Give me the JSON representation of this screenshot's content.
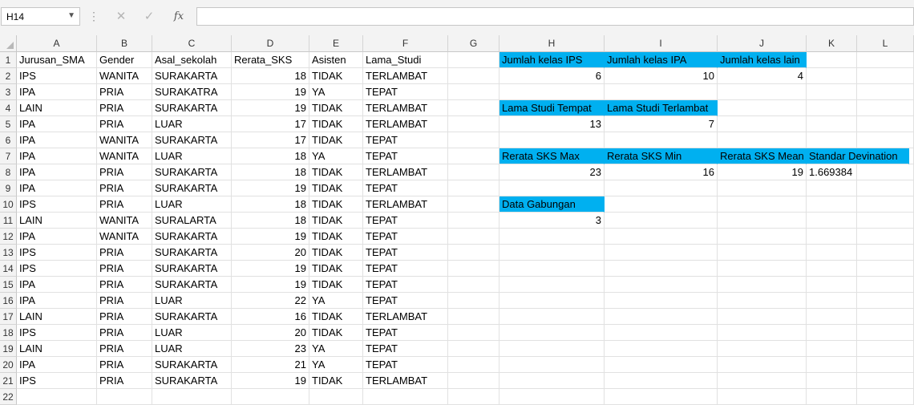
{
  "name_box": {
    "value": "H14"
  },
  "formula_bar": {
    "value": ""
  },
  "columns": [
    "A",
    "B",
    "C",
    "D",
    "E",
    "F",
    "G",
    "H",
    "I",
    "J",
    "K",
    "L"
  ],
  "rows": [
    "1",
    "2",
    "3",
    "4",
    "5",
    "6",
    "7",
    "8",
    "9",
    "10",
    "11",
    "12",
    "13",
    "14",
    "15",
    "16",
    "17",
    "18",
    "19",
    "20",
    "21",
    "22"
  ],
  "table": {
    "headers": [
      "Jurusan_SMA",
      "Gender",
      "Asal_sekolah",
      "Rerata_SKS",
      "Asisten",
      "Lama_Studi"
    ],
    "data": [
      [
        "IPS",
        "WANITA",
        "SURAKARTA",
        "18",
        "TIDAK",
        "TERLAMBAT"
      ],
      [
        "IPA",
        "PRIA",
        "SURAKATRA",
        "19",
        "YA",
        "TEPAT"
      ],
      [
        "LAIN",
        "PRIA",
        "SURAKARTA",
        "19",
        "TIDAK",
        "TERLAMBAT"
      ],
      [
        "IPA",
        "PRIA",
        "LUAR",
        "17",
        "TIDAK",
        "TERLAMBAT"
      ],
      [
        "IPA",
        "WANITA",
        "SURAKARTA",
        "17",
        "TIDAK",
        "TEPAT"
      ],
      [
        "IPA",
        "WANITA",
        "LUAR",
        "18",
        "YA",
        "TEPAT"
      ],
      [
        "IPA",
        "PRIA",
        "SURAKARTA",
        "18",
        "TIDAK",
        "TERLAMBAT"
      ],
      [
        "IPA",
        "PRIA",
        "SURAKARTA",
        "19",
        "TIDAK",
        "TEPAT"
      ],
      [
        "IPS",
        "PRIA",
        "LUAR",
        "18",
        "TIDAK",
        "TERLAMBAT"
      ],
      [
        "LAIN",
        "WANITA",
        "SURALARTA",
        "18",
        "TIDAK",
        "TEPAT"
      ],
      [
        "IPA",
        "WANITA",
        "SURAKARTA",
        "19",
        "TIDAK",
        "TEPAT"
      ],
      [
        "IPS",
        "PRIA",
        "SURAKARTA",
        "20",
        "TIDAK",
        "TEPAT"
      ],
      [
        "IPS",
        "PRIA",
        "SURAKARTA",
        "19",
        "TIDAK",
        "TEPAT"
      ],
      [
        "IPA",
        "PRIA",
        "SURAKARTA",
        "19",
        "TIDAK",
        "TEPAT"
      ],
      [
        "IPA",
        "PRIA",
        "LUAR",
        "22",
        "YA",
        "TEPAT"
      ],
      [
        "LAIN",
        "PRIA",
        "SURAKARTA",
        "16",
        "TIDAK",
        "TERLAMBAT"
      ],
      [
        "IPS",
        "PRIA",
        "LUAR",
        "20",
        "TIDAK",
        "TEPAT"
      ],
      [
        "LAIN",
        "PRIA",
        "LUAR",
        "23",
        "YA",
        "TEPAT"
      ],
      [
        "IPA",
        "PRIA",
        "SURAKARTA",
        "21",
        "YA",
        "TEPAT"
      ],
      [
        "IPS",
        "PRIA",
        "SURAKARTA",
        "19",
        "TIDAK",
        "TERLAMBAT"
      ]
    ]
  },
  "summary": {
    "jumlah_ips_label": "Jumlah kelas IPS",
    "jumlah_ips_value": "6",
    "jumlah_ipa_label": "Jumlah kelas IPA",
    "jumlah_ipa_value": "10",
    "jumlah_lain_label": "Jumlah kelas lain",
    "jumlah_lain_value": "4",
    "studi_tepat_label": "Lama Studi Tempat",
    "studi_tepat_value": "13",
    "studi_terlambat_label": "Lama Studi Terlambat",
    "studi_terlambat_value": "7",
    "sks_max_label": "Rerata SKS Max",
    "sks_max_value": "23",
    "sks_min_label": "Rerata SKS Min",
    "sks_min_value": "16",
    "sks_mean_label": "Rerata SKS Mean",
    "sks_mean_value": "19",
    "std_label": "Standar Devination",
    "std_value": "1.669384",
    "gabungan_label": "Data Gabungan",
    "gabungan_value": "3"
  },
  "colors": {
    "highlight": "#00b0f0",
    "header_bg": "#f3f3f3",
    "gridline": "#e1e1e1"
  },
  "icons": [
    "chevron-down-icon",
    "cancel-icon",
    "check-icon",
    "fx-icon"
  ]
}
